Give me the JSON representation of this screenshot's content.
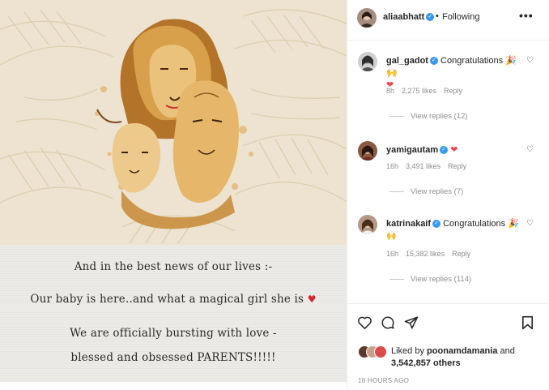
{
  "post": {
    "caption_lines": [
      "And in the best news of our lives :-",
      "Our baby is here..and what a magical girl she is",
      "We are officially bursting with love -",
      "blessed and obsessed PARENTS!!!!!"
    ],
    "caption_heart_icon": "red-heart-emoji",
    "colors": {
      "card_bg": "#ecebe7",
      "illustration_bg": "#ece2cf",
      "lion_ochre": "#c8842a"
    }
  },
  "header": {
    "username": "aliaabhatt",
    "dot": "•",
    "following_label": "Following",
    "more_label": "•••"
  },
  "comments": [
    {
      "username": "gal_gadot",
      "body": "Congratulations 🎉🙌",
      "second_line": "❤",
      "time": "8h",
      "likes": "2,275 likes",
      "reply_label": "Reply",
      "view_replies": "View replies (12)"
    },
    {
      "username": "yamigautam",
      "body": "❤",
      "time": "16h",
      "likes": "3,491 likes",
      "reply_label": "Reply",
      "view_replies": "View replies (7)"
    },
    {
      "username": "katrinakaif",
      "body": "Congratulations 🎉",
      "second_line": "🙌",
      "time": "16h",
      "likes": "15,382 likes",
      "reply_label": "Reply",
      "view_replies": "View replies (114)"
    }
  ],
  "likes": {
    "liked_by_prefix": "Liked by",
    "liked_by_user": "poonamdamania",
    "and_label": "and",
    "others_count": "3,542,857 others"
  },
  "timestamp": "18 HOURS AGO",
  "icons": [
    "heart-icon",
    "comment-icon",
    "share-icon",
    "bookmark-icon",
    "verified-badge-icon",
    "more-options-icon"
  ],
  "colors": {
    "verified_blue": "#3897f0",
    "muted_text": "#8e8e8e",
    "like_red": "#ed4956"
  }
}
